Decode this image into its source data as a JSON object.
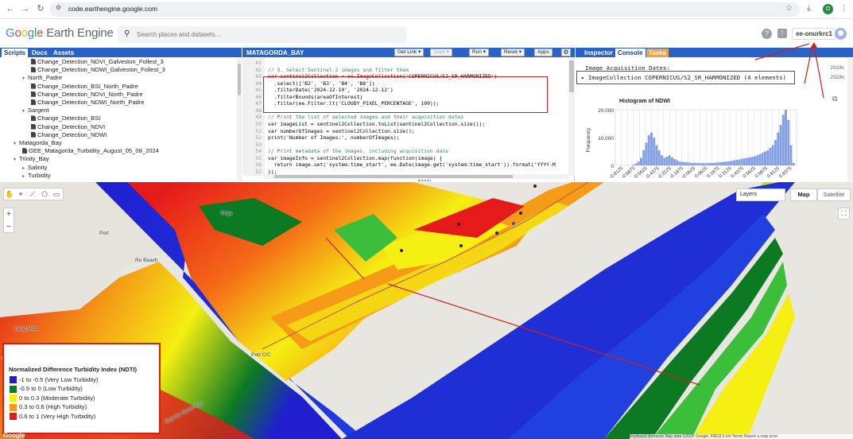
{
  "browser": {
    "url": "code.earthengine.google.com",
    "avatar_letter": "O"
  },
  "header": {
    "logo_google": [
      "G",
      "o",
      "o",
      "g",
      "l",
      "e"
    ],
    "logo_rest": " Earth Engine",
    "search_placeholder": "Search places and datasets...",
    "help": "?",
    "project": "ee-onurkrc1"
  },
  "left_panel": {
    "tabs": [
      "Scripts",
      "Docs",
      "Assets"
    ],
    "tree": [
      {
        "label": "Change_Detection_NDVI_Galveston_Follest_3",
        "type": "file",
        "indent": 3
      },
      {
        "label": "Change_Detection_NDWI_Galveston_Follest_3",
        "type": "file",
        "indent": 3
      },
      {
        "label": "North_Padre",
        "type": "folder",
        "indent": 2
      },
      {
        "label": "Change_Detection_BSI_North_Padre",
        "type": "file",
        "indent": 3
      },
      {
        "label": "Change_Detection_NDVI_North_Padre",
        "type": "file",
        "indent": 3
      },
      {
        "label": "Change_Detection_NDWI_North_Padre",
        "type": "file",
        "indent": 3
      },
      {
        "label": "Sargent",
        "type": "folder",
        "indent": 2
      },
      {
        "label": "Change_Detection_BSI",
        "type": "file",
        "indent": 3
      },
      {
        "label": "Change_Detection_NDVI",
        "type": "file",
        "indent": 3
      },
      {
        "label": "Change_Detection_NDWI",
        "type": "file",
        "indent": 3
      },
      {
        "label": "Matagorda_Bay",
        "type": "folder",
        "indent": 1
      },
      {
        "label": "GEE_Matagorda_Turbidity_August_05_08_2024",
        "type": "file",
        "indent": 2
      },
      {
        "label": "Trinity_Bay",
        "type": "folder",
        "indent": 1
      },
      {
        "label": "Salinity",
        "type": "collapsed",
        "indent": 2
      },
      {
        "label": "Turbidity",
        "type": "collapsed",
        "indent": 2
      }
    ]
  },
  "editor": {
    "title": "MATAGORDA_BAY",
    "buttons": [
      "Get Link",
      "Save",
      "Run",
      "Reset",
      "Apps"
    ],
    "lines": [
      {
        "n": "41",
        "text": ""
      },
      {
        "n": "42",
        "text": "// 3. Select Sentinel-2 images and filter them",
        "cls": "cm"
      },
      {
        "n": "43",
        "text": "var sentinel2Collection = ee.ImageCollection('COPERNICUS/S2_SR_HARMONIZED')"
      },
      {
        "n": "44",
        "text": "  .select(['B2', 'B3', 'B4', 'B8'])"
      },
      {
        "n": "45",
        "text": "  .filterDate('2024-12-10', '2024-12-12')"
      },
      {
        "n": "46",
        "text": "  .filterBounds(areaOfInterest)"
      },
      {
        "n": "47",
        "text": "  .filter(ee.Filter.lt('CLOUDY_PIXEL_PERCENTAGE', 100));"
      },
      {
        "n": "48",
        "text": ""
      },
      {
        "n": "49",
        "text": "// Print the list of selected images and their acquisition dates",
        "cls": "cm"
      },
      {
        "n": "50",
        "text": "var imageList = sentinel2Collection.toList(sentinel2Collection.size());"
      },
      {
        "n": "51",
        "text": "var numberOfImages = sentinel2Collection.size();"
      },
      {
        "n": "52",
        "text": "print('Number of Images:', numberOfImages);"
      },
      {
        "n": "53",
        "text": ""
      },
      {
        "n": "54",
        "text": "// Print metadata of the images, including acquisition date",
        "cls": "cm"
      },
      {
        "n": "55",
        "text": "var imageInfo = sentinel2Collection.map(function(image) {"
      },
      {
        "n": "56",
        "text": "  return image.set('system:time_start', ee.Date(image.get('system:time_start')).format('YYYY-M"
      },
      {
        "n": "57",
        "text": "});"
      }
    ]
  },
  "right_panel": {
    "tabs": [
      "Inspector",
      "Console",
      "Tasks"
    ],
    "acq_label": "Image Acquisition Dates:",
    "collection_line": "ImageCollection COPERNICUS/S2_SR_HARMONIZED (4 elements)",
    "json": "JSON",
    "histogram": {
      "title": "Histogram of NDWI",
      "ylabel": "Frequency",
      "yticks": [
        "20,000",
        "10,000",
        "0"
      ],
      "xticks": [
        "-0.8125",
        "-0.6875",
        "-0.5625",
        "-0.4375",
        "-0.3125",
        "-0.1875",
        "-0.0625",
        "0.0625",
        "0.1875",
        "0.3125",
        "0.4375",
        "0.5625",
        "0.6875",
        "0.8125",
        "0.9375"
      ]
    }
  },
  "map": {
    "tools": [
      "hand-icon",
      "marker-icon",
      "line-icon",
      "polygon-icon",
      "rectangle-icon"
    ],
    "zoom_in": "+",
    "zoom_out": "−",
    "layers": "Layers",
    "map_btn": "Map",
    "satellite_btn": "Satellite",
    "places": [
      {
        "name": "Long Mott"
      },
      {
        "name": "Port O'C"
      },
      {
        "name": "Port"
      },
      {
        "name": "Ro Beach"
      },
      {
        "name": "Espiritu Santo Bay"
      },
      {
        "name": "Finja"
      }
    ],
    "legend": {
      "title": "Normalized Difference Turbidity Index (NDTI)",
      "items": [
        {
          "label": "-1 to -0.5 (Very Low Turbidity)",
          "color": "#1f1fd0"
        },
        {
          "label": "-0.5 to 0 (Low Turbidity)",
          "color": "#0b7a22"
        },
        {
          "label": "0 to 0.3 (Moderate Turbidity)",
          "color": "#f5ef12"
        },
        {
          "label": "0.3 to 0.6 (High Turbidity)",
          "color": "#f59b17"
        },
        {
          "label": "0.6 to 1 (Very High Turbidity)",
          "color": "#e51b1b"
        }
      ]
    },
    "attribution": "Keyboard shortcuts   Map data ©2025 Google, INEGI   5 km   Terms   Report a map error",
    "google": "Google"
  }
}
